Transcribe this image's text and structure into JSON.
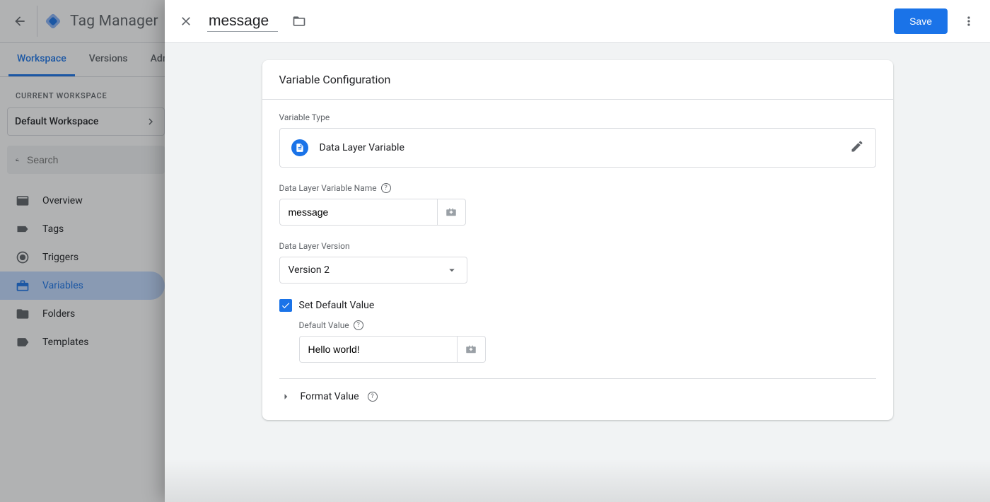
{
  "colors": {
    "accent": "#1a73e8"
  },
  "header": {
    "product": "Tag Manager"
  },
  "tabs": [
    "Workspace",
    "Versions",
    "Admin"
  ],
  "side": {
    "label": "CURRENT WORKSPACE",
    "workspace": "Default Workspace",
    "search_placeholder": "Search",
    "items": [
      "Overview",
      "Tags",
      "Triggers",
      "Variables",
      "Folders",
      "Templates"
    ]
  },
  "panel": {
    "name": "message",
    "save": "Save",
    "card_title": "Variable Configuration",
    "type_label": "Variable Type",
    "type_name": "Data Layer Variable",
    "var_name_label": "Data Layer Variable Name",
    "var_name_value": "message",
    "version_label": "Data Layer Version",
    "version_value": "Version 2",
    "set_default_label": "Set Default Value",
    "default_label": "Default Value",
    "default_value": "Hello world!",
    "format_label": "Format Value"
  }
}
